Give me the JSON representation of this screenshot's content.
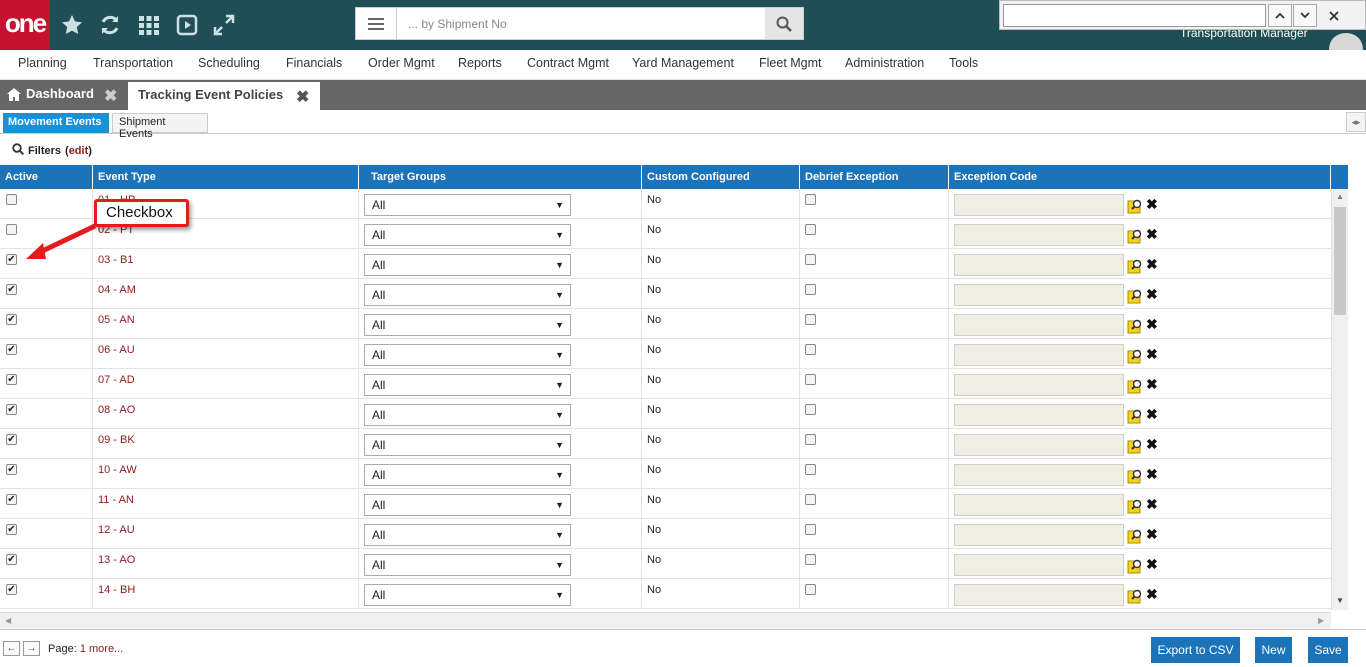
{
  "app": {
    "logo_text": "one",
    "user_label": "Transportation Manager"
  },
  "search": {
    "placeholder": "... by Shipment No",
    "value": ""
  },
  "find": {
    "value": ""
  },
  "icons": {
    "top": [
      "star-icon",
      "refresh-icon",
      "apps-grid-icon",
      "play-icon",
      "expand-icon"
    ]
  },
  "menu": {
    "items": [
      "Planning",
      "Transportation",
      "Scheduling",
      "Financials",
      "Order Mgmt",
      "Reports",
      "Contract Mgmt",
      "Yard Management",
      "Fleet Mgmt",
      "Administration",
      "Tools"
    ]
  },
  "tabs": {
    "dashboard": "Dashboard",
    "active": "Tracking Event Policies"
  },
  "subtabs": {
    "movement": "Movement Events",
    "shipment": "Shipment Events"
  },
  "filters": {
    "label": "Filters",
    "open": "(",
    "edit": "edit",
    "close": ")"
  },
  "grid": {
    "headers": [
      "Active",
      "Event Type",
      "Target Groups",
      "Custom Configured",
      "Debrief Exception",
      "Exception Code"
    ],
    "rows": [
      {
        "active": false,
        "event_type": "01 - HP",
        "target_group": "All",
        "custom": "No",
        "debrief": false,
        "exception_code": ""
      },
      {
        "active": false,
        "event_type": "02 - PT",
        "target_group": "All",
        "custom": "No",
        "debrief": false,
        "exception_code": ""
      },
      {
        "active": true,
        "event_type": "03 - B1",
        "target_group": "All",
        "custom": "No",
        "debrief": false,
        "exception_code": ""
      },
      {
        "active": true,
        "event_type": "04 - AM",
        "target_group": "All",
        "custom": "No",
        "debrief": false,
        "exception_code": ""
      },
      {
        "active": true,
        "event_type": "05 - AN",
        "target_group": "All",
        "custom": "No",
        "debrief": false,
        "exception_code": ""
      },
      {
        "active": true,
        "event_type": "06 - AU",
        "target_group": "All",
        "custom": "No",
        "debrief": false,
        "exception_code": ""
      },
      {
        "active": true,
        "event_type": "07 - AD",
        "target_group": "All",
        "custom": "No",
        "debrief": false,
        "exception_code": ""
      },
      {
        "active": true,
        "event_type": "08 - AO",
        "target_group": "All",
        "custom": "No",
        "debrief": false,
        "exception_code": ""
      },
      {
        "active": true,
        "event_type": "09 - BK",
        "target_group": "All",
        "custom": "No",
        "debrief": false,
        "exception_code": ""
      },
      {
        "active": true,
        "event_type": "10 - AW",
        "target_group": "All",
        "custom": "No",
        "debrief": false,
        "exception_code": ""
      },
      {
        "active": true,
        "event_type": "11 - AN",
        "target_group": "All",
        "custom": "No",
        "debrief": false,
        "exception_code": ""
      },
      {
        "active": true,
        "event_type": "12 - AU",
        "target_group": "All",
        "custom": "No",
        "debrief": false,
        "exception_code": ""
      },
      {
        "active": true,
        "event_type": "13 - AO",
        "target_group": "All",
        "custom": "No",
        "debrief": false,
        "exception_code": ""
      },
      {
        "active": true,
        "event_type": "14 - BH",
        "target_group": "All",
        "custom": "No",
        "debrief": false,
        "exception_code": ""
      }
    ]
  },
  "footer": {
    "page_label": "Page:",
    "page_number": "1",
    "more": "more...",
    "export": "Export to CSV",
    "new": "New",
    "save": "Save"
  },
  "callout": {
    "text": "Checkbox",
    "color": "#e21b1b"
  },
  "colors": {
    "topbar": "#1f4e57",
    "brand": "#c41230",
    "accent": "#1d73b8",
    "link": "#8b1a1a"
  }
}
